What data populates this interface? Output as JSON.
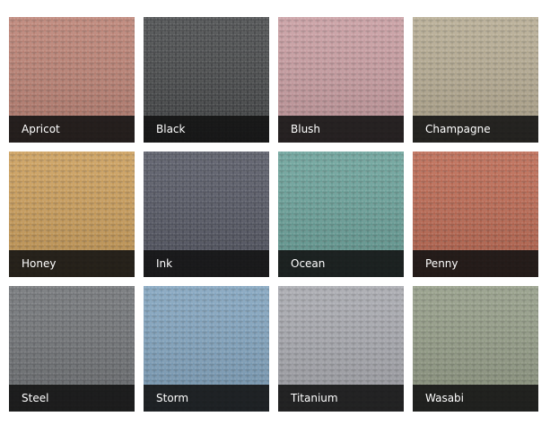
{
  "swatches": [
    {
      "label": "Apricot",
      "color": "#b16f5f"
    },
    {
      "label": "Black",
      "color": "#2b2d2f"
    },
    {
      "label": "Blush",
      "color": "#c08e93"
    },
    {
      "label": "Champagne",
      "color": "#ab9f82"
    },
    {
      "label": "Honey",
      "color": "#c38f42"
    },
    {
      "label": "Ink",
      "color": "#3b3e4c"
    },
    {
      "label": "Ocean",
      "color": "#54938a"
    },
    {
      "label": "Penny",
      "color": "#b15238"
    },
    {
      "label": "Steel",
      "color": "#5b5e62"
    },
    {
      "label": "Storm",
      "color": "#6e95b4"
    },
    {
      "label": "Titanium",
      "color": "#9a9ba2"
    },
    {
      "label": "Wasabi",
      "color": "#838d74"
    }
  ]
}
